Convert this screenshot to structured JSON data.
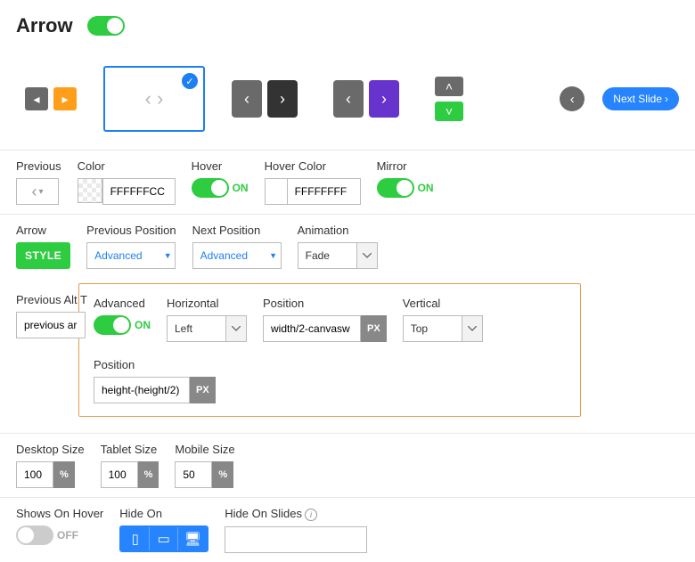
{
  "header": {
    "title": "Arrow"
  },
  "nextSlide": {
    "label": "Next Slide"
  },
  "row1": {
    "previous": {
      "label": "Previous"
    },
    "color": {
      "label": "Color",
      "value": "FFFFFFCC"
    },
    "hover": {
      "label": "Hover",
      "state": "ON"
    },
    "hoverColor": {
      "label": "Hover Color",
      "value": "FFFFFFFF"
    },
    "mirror": {
      "label": "Mirror",
      "state": "ON"
    }
  },
  "row2": {
    "arrow": {
      "label": "Arrow",
      "btn": "STYLE"
    },
    "prevPos": {
      "label": "Previous Position",
      "value": "Advanced"
    },
    "nextPos": {
      "label": "Next Position",
      "value": "Advanced"
    },
    "anim": {
      "label": "Animation",
      "value": "Fade"
    }
  },
  "prevAlt": {
    "label": "Previous Alt T",
    "value": "previous arr"
  },
  "adv": {
    "adv": {
      "label": "Advanced",
      "state": "ON"
    },
    "horiz": {
      "label": "Horizontal",
      "value": "Left"
    },
    "pos1": {
      "label": "Position",
      "value": "width/2-canvasw",
      "unit": "PX"
    },
    "vert": {
      "label": "Vertical",
      "value": "Top"
    },
    "pos2": {
      "label": "Position",
      "value": "height-(height/2)",
      "unit": "PX"
    }
  },
  "sizes": {
    "desktop": {
      "label": "Desktop Size",
      "value": "100",
      "unit": "%"
    },
    "tablet": {
      "label": "Tablet Size",
      "value": "100",
      "unit": "%"
    },
    "mobile": {
      "label": "Mobile Size",
      "value": "50",
      "unit": "%"
    }
  },
  "row5": {
    "showsHover": {
      "label": "Shows On Hover",
      "state": "OFF"
    },
    "hideOn": {
      "label": "Hide On"
    },
    "hideOnSlides": {
      "label": "Hide On Slides"
    }
  }
}
